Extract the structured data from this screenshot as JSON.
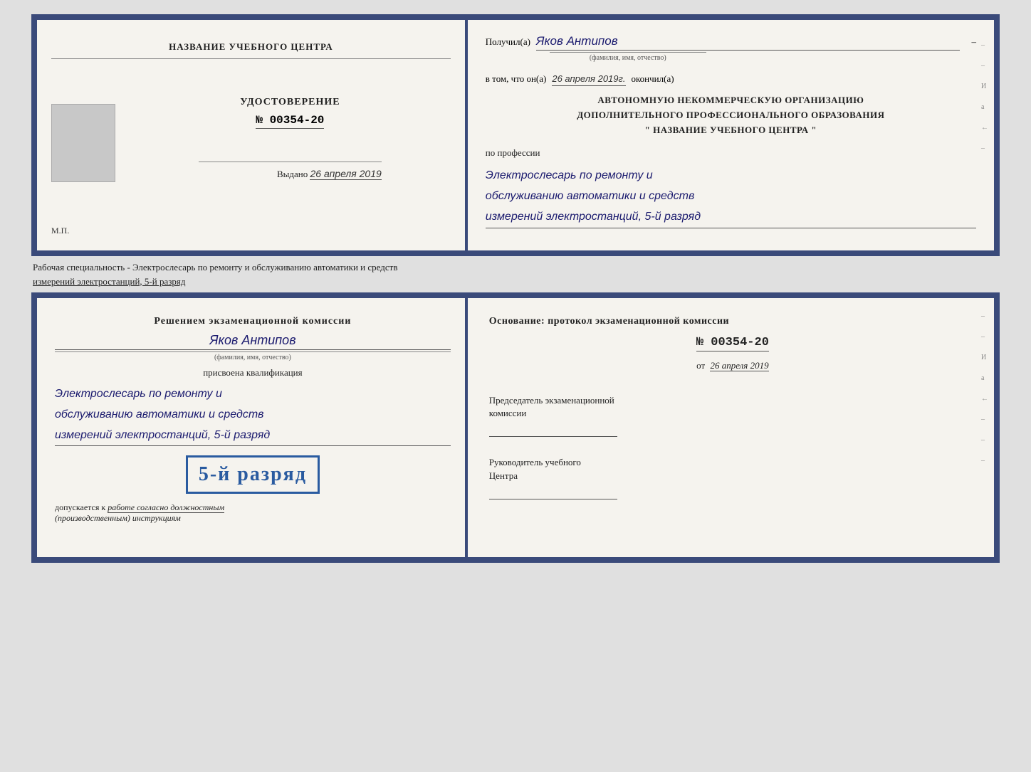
{
  "top_document": {
    "left": {
      "org_title": "НАЗВАНИЕ УЧЕБНОГО ЦЕНТРА",
      "cert_label": "УДОСТОВЕРЕНИЕ",
      "cert_number": "№ 00354-20",
      "issued_label": "Выдано",
      "issued_date": "26 апреля 2019",
      "mp_label": "М.П."
    },
    "right": {
      "received_label": "Получил(а)",
      "recipient_name": "Яков Антипов",
      "fio_sublabel": "(фамилия, имя, отчество)",
      "date_prefix": "в том, что он(а)",
      "date_value": "26 апреля 2019г.",
      "date_suffix": "окончил(а)",
      "org_line1": "АВТОНОМНУЮ НЕКОММЕРЧЕСКУЮ ОРГАНИЗАЦИЮ",
      "org_line2": "ДОПОЛНИТЕЛЬНОГО ПРОФЕССИОНАЛЬНОГО ОБРАЗОВАНИЯ",
      "org_line3": "\"    НАЗВАНИЕ УЧЕБНОГО ЦЕНТРА    \"",
      "profession_label": "по профессии",
      "profession_line1": "Электрослесарь по ремонту и",
      "profession_line2": "обслуживанию автоматики и средств",
      "profession_line3": "измерений электростанций, 5-й разряд",
      "side_chars": [
        "И",
        "а",
        "←",
        "–",
        "–",
        "–"
      ]
    }
  },
  "middle": {
    "text": "Рабочая специальность - Электрослесарь по ремонту и обслуживанию автоматики и средств",
    "text2": "измерений электростанций, 5-й разряд"
  },
  "bottom_document": {
    "left": {
      "commission_title": "Решением экзаменационной комиссии",
      "person_name": "Яков Антипов",
      "fio_sublabel": "(фамилия, имя, отчество)",
      "qualification_label": "присвоена квалификация",
      "qual_line1": "Электрослесарь по ремонту и",
      "qual_line2": "обслуживанию автоматики и средств",
      "qual_line3": "измерений электростанций, 5-й разряд",
      "rank_badge": "5-й разряд",
      "allows_label": "допускается к",
      "allows_text": "работе согласно должностным",
      "allows_text2": "(производственным) инструкциям"
    },
    "right": {
      "osnov_label": "Основание: протокол экзаменационной комиссии",
      "protocol_number": "№ 00354-20",
      "ot_label": "от",
      "ot_date": "26 апреля 2019",
      "chairman_title": "Председатель экзаменационной",
      "chairman_title2": "комиссии",
      "head_title": "Руководитель учебного",
      "head_title2": "Центра",
      "side_chars": [
        "И",
        "а",
        "←",
        "–",
        "–",
        "–",
        "–"
      ]
    }
  }
}
